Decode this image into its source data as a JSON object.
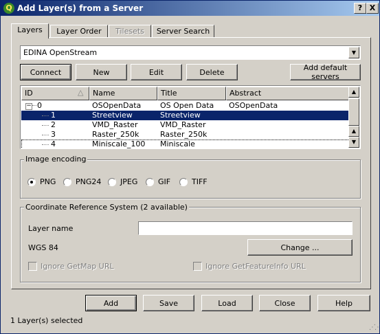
{
  "window": {
    "title": "Add Layer(s) from a Server",
    "help_button": "?",
    "close_button": "X"
  },
  "tabs": [
    {
      "label": "Layers"
    },
    {
      "label": "Layer Order"
    },
    {
      "label": "Tilesets"
    },
    {
      "label": "Server Search"
    }
  ],
  "server": {
    "selected": "EDINA OpenStream"
  },
  "server_buttons": {
    "connect": "Connect",
    "new": "New",
    "edit": "Edit",
    "delete": "Delete",
    "add_default": "Add default servers"
  },
  "layer_table": {
    "columns": {
      "id": "ID",
      "name": "Name",
      "title": "Title",
      "abstract": "Abstract"
    },
    "rows": [
      {
        "id": "0",
        "name": "OSOpenData",
        "title": "OS Open Data",
        "abstract": "OSOpenData",
        "expander": "−"
      },
      {
        "id": "1",
        "name": "Streetview",
        "title": "Streetview",
        "abstract": ""
      },
      {
        "id": "2",
        "name": "VMD_Raster",
        "title": "VMD_Raster",
        "abstract": ""
      },
      {
        "id": "3",
        "name": "Raster_250k",
        "title": "Raster_250k",
        "abstract": ""
      },
      {
        "id": "4",
        "name": "Miniscale_100",
        "title": "Miniscale",
        "abstract": ""
      }
    ]
  },
  "image_encoding": {
    "title": "Image encoding",
    "options": [
      "PNG",
      "PNG24",
      "JPEG",
      "GIF",
      "TIFF"
    ],
    "selected": "PNG"
  },
  "crs": {
    "title": "Coordinate Reference System (2 available)",
    "layer_name_label": "Layer name",
    "layer_name_value": "",
    "current_crs": "WGS 84",
    "change_button": "Change ...",
    "ignore_getmap": "Ignore GetMap URL",
    "ignore_getfeatureinfo": "Ignore GetFeatureInfo URL"
  },
  "dialog_buttons": {
    "add": "Add",
    "save": "Save",
    "load": "Load",
    "close": "Close",
    "help": "Help"
  },
  "status": "1 Layer(s) selected",
  "colors": {
    "titlebar_start": "#0a246a",
    "titlebar_end": "#a6caf0",
    "selection": "#0a246a",
    "face": "#d4d0c8"
  }
}
